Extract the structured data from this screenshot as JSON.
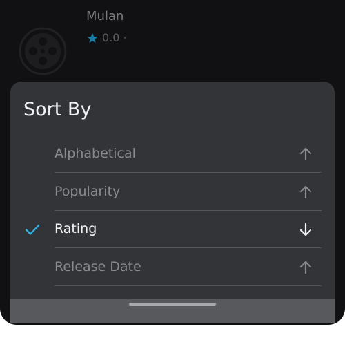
{
  "background_item": {
    "title": "Mulan",
    "rating": "0.0",
    "separator": "·",
    "icons": {
      "poster": "film-reel-icon",
      "rating": "star-icon"
    },
    "colors": {
      "star": "#1ba1d6"
    }
  },
  "sheet": {
    "title": "Sort By",
    "options": [
      {
        "label": "Alphabetical",
        "selected": false,
        "direction": "ascending",
        "arrow_icon": "arrow-up-icon"
      },
      {
        "label": "Popularity",
        "selected": false,
        "direction": "ascending",
        "arrow_icon": "arrow-up-icon"
      },
      {
        "label": "Rating",
        "selected": true,
        "direction": "descending",
        "arrow_icon": "arrow-down-icon",
        "check_icon": "check-icon"
      },
      {
        "label": "Release Date",
        "selected": false,
        "direction": "ascending",
        "arrow_icon": "arrow-up-icon"
      }
    ],
    "colors": {
      "accent": "#29b6e6",
      "sheet_bg": "#333437",
      "selected_text": "#f4f4f6",
      "unselected_text": "#8a8a8e"
    }
  }
}
